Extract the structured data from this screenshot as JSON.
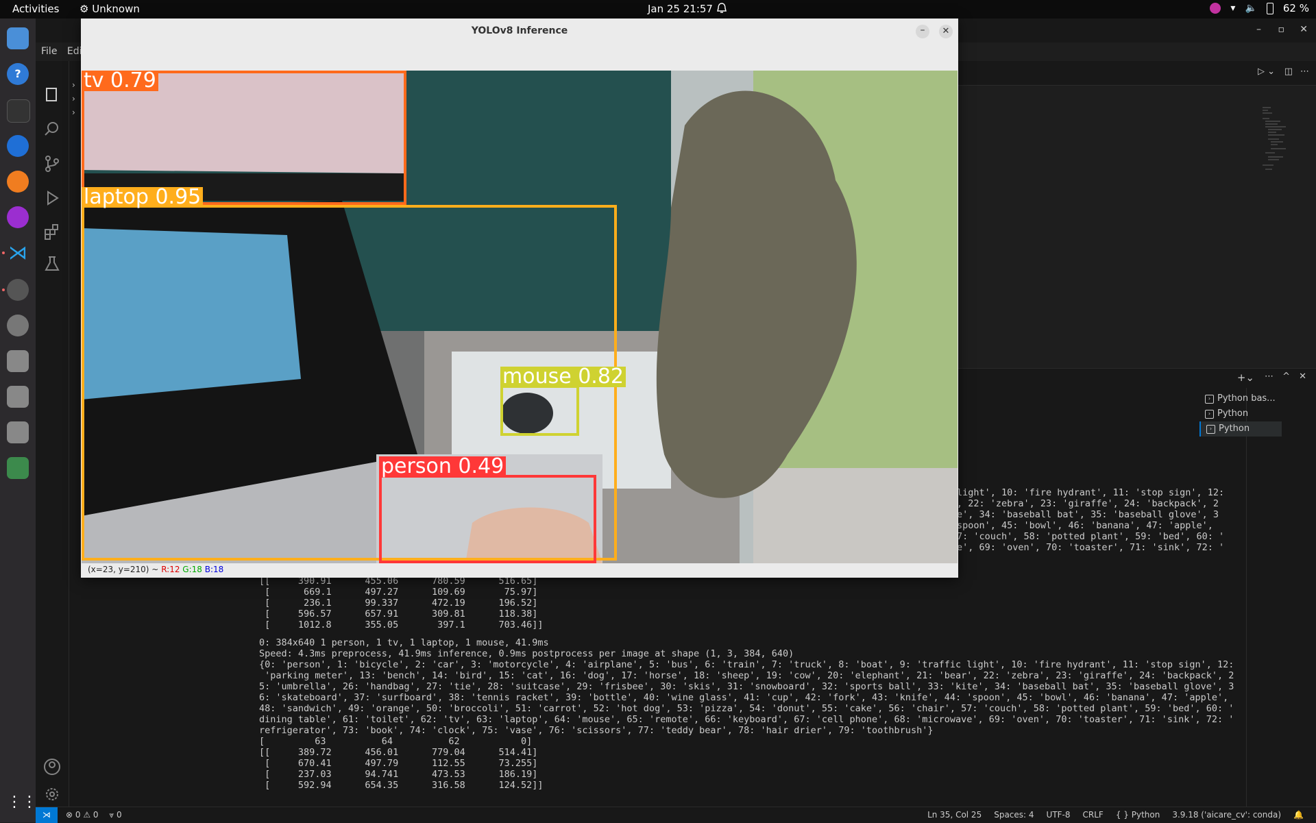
{
  "topbar": {
    "activities": "Activities",
    "app_name": "Unknown",
    "clock": "Jan 25  21:57",
    "battery": "62 %"
  },
  "vscode": {
    "menu_file": "File",
    "menu_edit": "Edi",
    "terminals": [
      "Python bas...",
      "Python",
      "Python"
    ],
    "terminal_top_lines": [
      "light', 10: 'fire hydrant', 11: 'stop sign', 12:",
      ", 22: 'zebra', 23: 'giraffe', 24: 'backpack', 2",
      "e', 34: 'baseball bat', 35: 'baseball glove', 3",
      "spoon', 45: 'bowl', 46: 'banana', 47: 'apple',",
      "7: 'couch', 58: 'potted plant', 59: 'bed', 60: '",
      "e', 69: 'oven', 70: 'toaster', 71: 'sink', 72: '"
    ],
    "terminal_arr1": "[[     390.91      455.06      780.59      516.65]\n [      669.1      497.27      109.69       75.97]\n [      236.1      99.337      472.19      196.52]\n [     596.57      657.91      309.81      118.38]\n [     1012.8      355.05       397.1      703.46]]",
    "terminal_text": "0: 384x640 1 person, 1 tv, 1 laptop, 1 mouse, 41.9ms\nSpeed: 4.3ms preprocess, 41.9ms inference, 0.9ms postprocess per image at shape (1, 3, 384, 640)\n{0: 'person', 1: 'bicycle', 2: 'car', 3: 'motorcycle', 4: 'airplane', 5: 'bus', 6: 'train', 7: 'truck', 8: 'boat', 9: 'traffic light', 10: 'fire hydrant', 11: 'stop sign', 12:\n 'parking meter', 13: 'bench', 14: 'bird', 15: 'cat', 16: 'dog', 17: 'horse', 18: 'sheep', 19: 'cow', 20: 'elephant', 21: 'bear', 22: 'zebra', 23: 'giraffe', 24: 'backpack', 2\n5: 'umbrella', 26: 'handbag', 27: 'tie', 28: 'suitcase', 29: 'frisbee', 30: 'skis', 31: 'snowboard', 32: 'sports ball', 33: 'kite', 34: 'baseball bat', 35: 'baseball glove', 3\n6: 'skateboard', 37: 'surfboard', 38: 'tennis racket', 39: 'bottle', 40: 'wine glass', 41: 'cup', 42: 'fork', 43: 'knife', 44: 'spoon', 45: 'bowl', 46: 'banana', 47: 'apple',\n48: 'sandwich', 49: 'orange', 50: 'broccoli', 51: 'carrot', 52: 'hot dog', 53: 'pizza', 54: 'donut', 55: 'cake', 56: 'chair', 57: 'couch', 58: 'potted plant', 59: 'bed', 60: '\ndining table', 61: 'toilet', 62: 'tv', 63: 'laptop', 64: 'mouse', 65: 'remote', 66: 'keyboard', 67: 'cell phone', 68: 'microwave', 69: 'oven', 70: 'toaster', 71: 'sink', 72: '\nrefrigerator', 73: 'book', 74: 'clock', 75: 'vase', 76: 'scissors', 77: 'teddy bear', 78: 'hair drier', 79: 'toothbrush'}\n[         63          64          62           0]\n[[     389.72      456.01      779.04      514.41]\n [     670.41      497.79      112.55      73.255]\n [     237.03      94.741      473.53      186.19]\n [     592.94      654.35      316.58      124.52]]",
    "status_problems": "⊗ 0 ⚠ 0",
    "status_ports": "⩔ 0",
    "status_right": [
      "Ln 35, Col 25",
      "Spaces: 4",
      "UTF-8",
      "CRLF",
      "{ } Python",
      "3.9.18 ('aicare_cv': conda)"
    ]
  },
  "yolo": {
    "title": "YOLOv8 Inference",
    "close": "✕",
    "minimize": "–",
    "status_coords": "(x=23, y=210) ~",
    "status_r": "R:12",
    "status_g": "G:18",
    "status_b": "B:18",
    "detections": [
      {
        "label": "tv 0.79",
        "color": "#ff6a1c"
      },
      {
        "label": "laptop 0.95",
        "color": "#ffae1c"
      },
      {
        "label": "mouse 0.82",
        "color": "#cfd231"
      },
      {
        "label": "person 0.49",
        "color": "#ff3838"
      }
    ]
  }
}
